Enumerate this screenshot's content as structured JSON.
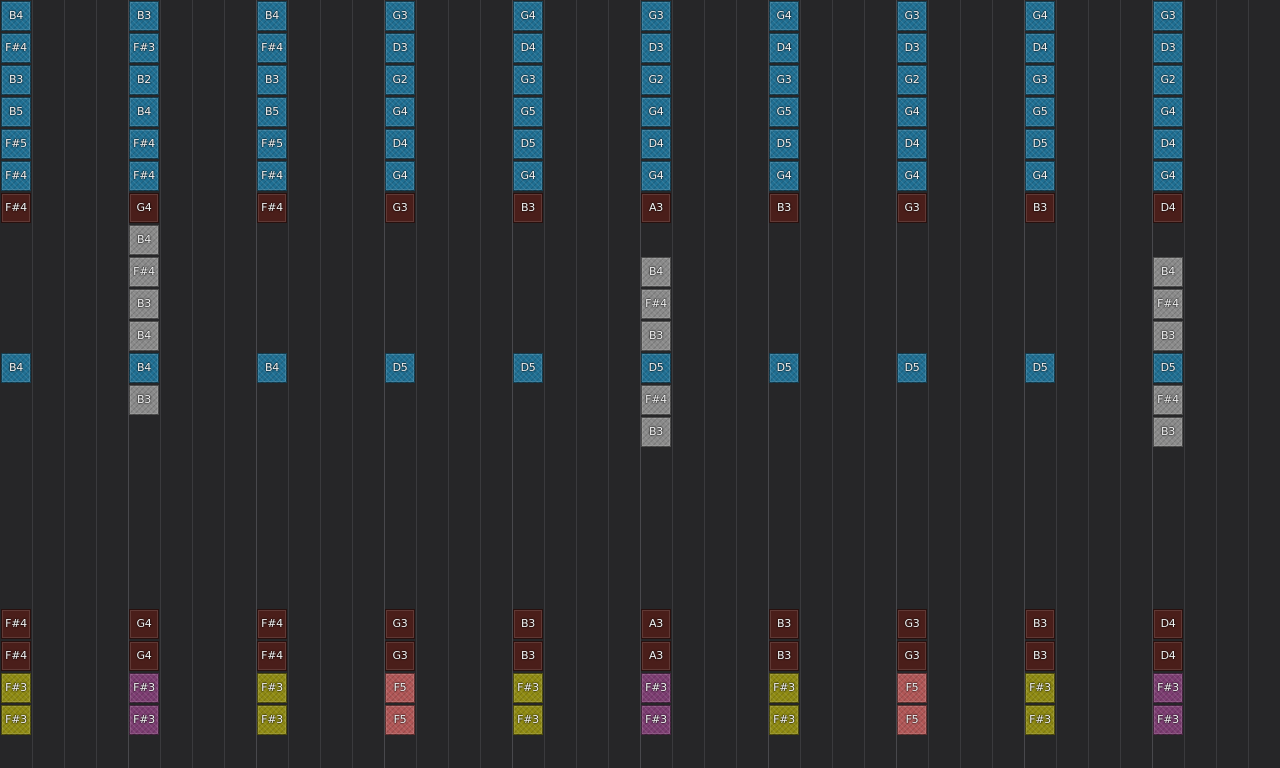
{
  "sequencer": {
    "columns": [
      {
        "start": 0,
        "notes": [
          {
            "row": 0,
            "label": "B4",
            "kind": "lead"
          },
          {
            "row": 1,
            "label": "F#4",
            "kind": "lead"
          },
          {
            "row": 2,
            "label": "B3",
            "kind": "lead"
          },
          {
            "row": 3,
            "label": "B5",
            "kind": "lead"
          },
          {
            "row": 4,
            "label": "F#5",
            "kind": "lead"
          },
          {
            "row": 5,
            "label": "F#4",
            "kind": "lead"
          },
          {
            "row": 6,
            "label": "F#4",
            "kind": "bass"
          },
          {
            "row": 11,
            "label": "B4",
            "kind": "lead"
          },
          {
            "row": 19,
            "label": "F#4",
            "kind": "bass"
          },
          {
            "row": 20,
            "label": "F#4",
            "kind": "bass"
          },
          {
            "row": 21,
            "label": "F#3",
            "kind": "olive"
          },
          {
            "row": 22,
            "label": "F#3",
            "kind": "olive"
          }
        ]
      },
      {
        "start": 4,
        "notes": [
          {
            "row": 0,
            "label": "B3",
            "kind": "lead"
          },
          {
            "row": 1,
            "label": "F#3",
            "kind": "lead"
          },
          {
            "row": 2,
            "label": "B2",
            "kind": "lead"
          },
          {
            "row": 3,
            "label": "B4",
            "kind": "lead"
          },
          {
            "row": 4,
            "label": "F#4",
            "kind": "lead"
          },
          {
            "row": 5,
            "label": "F#4",
            "kind": "lead"
          },
          {
            "row": 6,
            "label": "G4",
            "kind": "bass"
          },
          {
            "row": 7,
            "label": "B4",
            "kind": "ghost"
          },
          {
            "row": 8,
            "label": "F#4",
            "kind": "ghost"
          },
          {
            "row": 9,
            "label": "B3",
            "kind": "ghost"
          },
          {
            "row": 10,
            "label": "B4",
            "kind": "ghost"
          },
          {
            "row": 11,
            "label": "B4",
            "kind": "lead"
          },
          {
            "row": 12,
            "label": "B3",
            "kind": "ghost"
          },
          {
            "row": 19,
            "label": "G4",
            "kind": "bass"
          },
          {
            "row": 20,
            "label": "G4",
            "kind": "bass"
          },
          {
            "row": 21,
            "label": "F#3",
            "kind": "plum"
          },
          {
            "row": 22,
            "label": "F#3",
            "kind": "plum"
          }
        ]
      },
      {
        "start": 8,
        "notes": [
          {
            "row": 0,
            "label": "B4",
            "kind": "lead"
          },
          {
            "row": 1,
            "label": "F#4",
            "kind": "lead"
          },
          {
            "row": 2,
            "label": "B3",
            "kind": "lead"
          },
          {
            "row": 3,
            "label": "B5",
            "kind": "lead"
          },
          {
            "row": 4,
            "label": "F#5",
            "kind": "lead"
          },
          {
            "row": 5,
            "label": "F#4",
            "kind": "lead"
          },
          {
            "row": 6,
            "label": "F#4",
            "kind": "bass"
          },
          {
            "row": 11,
            "label": "B4",
            "kind": "lead"
          },
          {
            "row": 19,
            "label": "F#4",
            "kind": "bass"
          },
          {
            "row": 20,
            "label": "F#4",
            "kind": "bass"
          },
          {
            "row": 21,
            "label": "F#3",
            "kind": "olive"
          },
          {
            "row": 22,
            "label": "F#3",
            "kind": "olive"
          }
        ]
      },
      {
        "start": 12,
        "notes": [
          {
            "row": 0,
            "label": "G3",
            "kind": "lead"
          },
          {
            "row": 1,
            "label": "D3",
            "kind": "lead"
          },
          {
            "row": 2,
            "label": "G2",
            "kind": "lead"
          },
          {
            "row": 3,
            "label": "G4",
            "kind": "lead"
          },
          {
            "row": 4,
            "label": "D4",
            "kind": "lead"
          },
          {
            "row": 5,
            "label": "G4",
            "kind": "lead"
          },
          {
            "row": 6,
            "label": "G3",
            "kind": "bass"
          },
          {
            "row": 11,
            "label": "D5",
            "kind": "lead"
          },
          {
            "row": 19,
            "label": "G3",
            "kind": "bass"
          },
          {
            "row": 20,
            "label": "G3",
            "kind": "bass"
          },
          {
            "row": 21,
            "label": "F5",
            "kind": "rose"
          },
          {
            "row": 22,
            "label": "F5",
            "kind": "rose"
          }
        ]
      },
      {
        "start": 16,
        "notes": [
          {
            "row": 0,
            "label": "G4",
            "kind": "lead"
          },
          {
            "row": 1,
            "label": "D4",
            "kind": "lead"
          },
          {
            "row": 2,
            "label": "G3",
            "kind": "lead"
          },
          {
            "row": 3,
            "label": "G5",
            "kind": "lead"
          },
          {
            "row": 4,
            "label": "D5",
            "kind": "lead"
          },
          {
            "row": 5,
            "label": "G4",
            "kind": "lead"
          },
          {
            "row": 6,
            "label": "B3",
            "kind": "bass"
          },
          {
            "row": 11,
            "label": "D5",
            "kind": "lead"
          },
          {
            "row": 19,
            "label": "B3",
            "kind": "bass"
          },
          {
            "row": 20,
            "label": "B3",
            "kind": "bass"
          },
          {
            "row": 21,
            "label": "F#3",
            "kind": "olive"
          },
          {
            "row": 22,
            "label": "F#3",
            "kind": "olive"
          }
        ]
      },
      {
        "start": 20,
        "notes": [
          {
            "row": 0,
            "label": "G3",
            "kind": "lead"
          },
          {
            "row": 1,
            "label": "D3",
            "kind": "lead"
          },
          {
            "row": 2,
            "label": "G2",
            "kind": "lead"
          },
          {
            "row": 3,
            "label": "G4",
            "kind": "lead"
          },
          {
            "row": 4,
            "label": "D4",
            "kind": "lead"
          },
          {
            "row": 5,
            "label": "G4",
            "kind": "lead"
          },
          {
            "row": 6,
            "label": "A3",
            "kind": "bass"
          },
          {
            "row": 8,
            "label": "B4",
            "kind": "ghost"
          },
          {
            "row": 9,
            "label": "F#4",
            "kind": "ghost"
          },
          {
            "row": 10,
            "label": "B3",
            "kind": "ghost"
          },
          {
            "row": 11,
            "label": "D5",
            "kind": "lead"
          },
          {
            "row": 12,
            "label": "F#4",
            "kind": "ghost"
          },
          {
            "row": 13,
            "label": "B3",
            "kind": "ghost"
          },
          {
            "row": 19,
            "label": "A3",
            "kind": "bass"
          },
          {
            "row": 20,
            "label": "A3",
            "kind": "bass"
          },
          {
            "row": 21,
            "label": "F#3",
            "kind": "plum"
          },
          {
            "row": 22,
            "label": "F#3",
            "kind": "plum"
          }
        ]
      },
      {
        "start": 24,
        "notes": [
          {
            "row": 0,
            "label": "G4",
            "kind": "lead"
          },
          {
            "row": 1,
            "label": "D4",
            "kind": "lead"
          },
          {
            "row": 2,
            "label": "G3",
            "kind": "lead"
          },
          {
            "row": 3,
            "label": "G5",
            "kind": "lead"
          },
          {
            "row": 4,
            "label": "D5",
            "kind": "lead"
          },
          {
            "row": 5,
            "label": "G4",
            "kind": "lead"
          },
          {
            "row": 6,
            "label": "B3",
            "kind": "bass"
          },
          {
            "row": 11,
            "label": "D5",
            "kind": "lead"
          },
          {
            "row": 19,
            "label": "B3",
            "kind": "bass"
          },
          {
            "row": 20,
            "label": "B3",
            "kind": "bass"
          },
          {
            "row": 21,
            "label": "F#3",
            "kind": "olive"
          },
          {
            "row": 22,
            "label": "F#3",
            "kind": "olive"
          }
        ]
      },
      {
        "start": 28,
        "notes": [
          {
            "row": 0,
            "label": "G3",
            "kind": "lead"
          },
          {
            "row": 1,
            "label": "D3",
            "kind": "lead"
          },
          {
            "row": 2,
            "label": "G2",
            "kind": "lead"
          },
          {
            "row": 3,
            "label": "G4",
            "kind": "lead"
          },
          {
            "row": 4,
            "label": "D4",
            "kind": "lead"
          },
          {
            "row": 5,
            "label": "G4",
            "kind": "lead"
          },
          {
            "row": 6,
            "label": "G3",
            "kind": "bass"
          },
          {
            "row": 11,
            "label": "D5",
            "kind": "lead"
          },
          {
            "row": 19,
            "label": "G3",
            "kind": "bass"
          },
          {
            "row": 20,
            "label": "G3",
            "kind": "bass"
          },
          {
            "row": 21,
            "label": "F5",
            "kind": "rose"
          },
          {
            "row": 22,
            "label": "F5",
            "kind": "rose"
          }
        ]
      },
      {
        "start": 32,
        "notes": [
          {
            "row": 0,
            "label": "G4",
            "kind": "lead"
          },
          {
            "row": 1,
            "label": "D4",
            "kind": "lead"
          },
          {
            "row": 2,
            "label": "G3",
            "kind": "lead"
          },
          {
            "row": 3,
            "label": "G5",
            "kind": "lead"
          },
          {
            "row": 4,
            "label": "D5",
            "kind": "lead"
          },
          {
            "row": 5,
            "label": "G4",
            "kind": "lead"
          },
          {
            "row": 6,
            "label": "B3",
            "kind": "bass"
          },
          {
            "row": 11,
            "label": "D5",
            "kind": "lead"
          },
          {
            "row": 19,
            "label": "B3",
            "kind": "bass"
          },
          {
            "row": 20,
            "label": "B3",
            "kind": "bass"
          },
          {
            "row": 21,
            "label": "F#3",
            "kind": "olive"
          },
          {
            "row": 22,
            "label": "F#3",
            "kind": "olive"
          }
        ]
      },
      {
        "start": 36,
        "notes": [
          {
            "row": 0,
            "label": "G3",
            "kind": "lead"
          },
          {
            "row": 1,
            "label": "D3",
            "kind": "lead"
          },
          {
            "row": 2,
            "label": "G2",
            "kind": "lead"
          },
          {
            "row": 3,
            "label": "G4",
            "kind": "lead"
          },
          {
            "row": 4,
            "label": "D4",
            "kind": "lead"
          },
          {
            "row": 5,
            "label": "G4",
            "kind": "lead"
          },
          {
            "row": 6,
            "label": "D4",
            "kind": "bass"
          },
          {
            "row": 8,
            "label": "B4",
            "kind": "ghost"
          },
          {
            "row": 9,
            "label": "F#4",
            "kind": "ghost"
          },
          {
            "row": 10,
            "label": "B3",
            "kind": "ghost"
          },
          {
            "row": 11,
            "label": "D5",
            "kind": "lead"
          },
          {
            "row": 12,
            "label": "F#4",
            "kind": "ghost"
          },
          {
            "row": 13,
            "label": "B3",
            "kind": "ghost"
          },
          {
            "row": 19,
            "label": "D4",
            "kind": "bass"
          },
          {
            "row": 20,
            "label": "D4",
            "kind": "bass"
          },
          {
            "row": 21,
            "label": "F#3",
            "kind": "plum"
          },
          {
            "row": 22,
            "label": "F#3",
            "kind": "plum"
          }
        ]
      }
    ]
  },
  "colors": {
    "background": "#262628",
    "gridline": "#3a3a3d",
    "gridline_major": "#48484c",
    "lead": "#1f6f93",
    "ghost": "#8a8a8a",
    "bass": "#4a1e1a",
    "olive": "#8f8a12",
    "plum": "#7d3d72",
    "rose": "#b05656"
  }
}
